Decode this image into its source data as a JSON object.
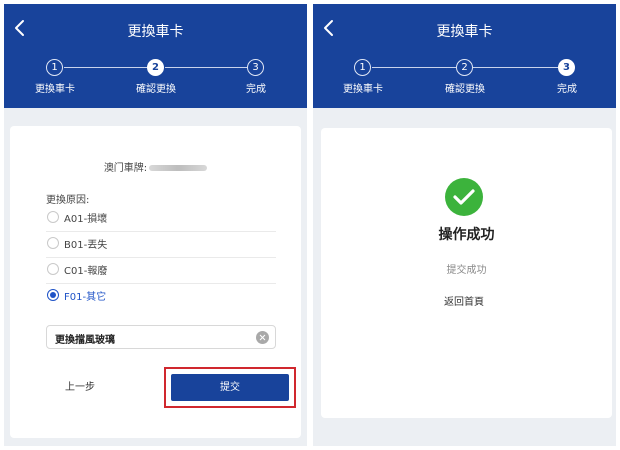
{
  "left_panel": {
    "title": "更換車卡",
    "steps": [
      {
        "number": "1",
        "label": "更換車卡"
      },
      {
        "number": "2",
        "label": "確認更換"
      },
      {
        "number": "3",
        "label": "完成"
      }
    ],
    "active_step": 2,
    "plate_label": "澳门車牌:",
    "reason_label": "更換原因:",
    "options": [
      {
        "label": "A01-損壞",
        "selected": false
      },
      {
        "label": "B01-丟失",
        "selected": false
      },
      {
        "label": "C01-報廢",
        "selected": false
      },
      {
        "label": "F01-其它",
        "selected": true
      }
    ],
    "reason_value": "更換擋風玻璃",
    "prev_label": "上一步",
    "submit_label": "提交"
  },
  "right_panel": {
    "title": "更換車卡",
    "steps": [
      {
        "number": "1",
        "label": "更換車卡"
      },
      {
        "number": "2",
        "label": "確認更換"
      },
      {
        "number": "3",
        "label": "完成"
      }
    ],
    "active_step": 3,
    "success_title": "操作成功",
    "success_subtitle": "提交成功",
    "home_label": "返回首頁"
  },
  "colors": {
    "header": "#18439b",
    "accent": "#1f53c7",
    "success": "#3cb33c",
    "highlight": "#d0282e"
  }
}
